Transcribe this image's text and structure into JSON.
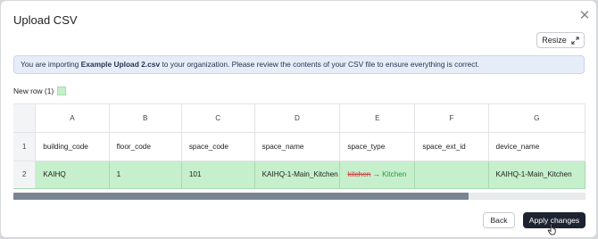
{
  "modal": {
    "title": "Upload CSV",
    "close_glyph": "✕"
  },
  "toolbar": {
    "resize_label": "Resize"
  },
  "banner": {
    "prefix": "You are importing ",
    "filename": "Example Upload 2.csv",
    "suffix": " to your organization. Please review the contents of your CSV file to ensure everything is correct."
  },
  "legend": {
    "new_row_label": "New row (1)",
    "new_row_color": "#c6efcc"
  },
  "table": {
    "column_letters": [
      "A",
      "B",
      "C",
      "D",
      "E",
      "F",
      "G"
    ],
    "row_numbers": [
      "1",
      "2"
    ],
    "headers": [
      "building_code",
      "floor_code",
      "space_code",
      "space_name",
      "space_type",
      "space_ext_id",
      "device_name"
    ],
    "rows": [
      {
        "building_code": "KAIHQ",
        "floor_code": "1",
        "space_code": "101",
        "space_name": "KAIHQ-1-Main_Kitchen",
        "space_type_old": "kitchen",
        "space_type_arrow": "→",
        "space_type_new": "Kitchen",
        "space_ext_id": "",
        "device_name": "KAIHQ-1-Main_Kitchen"
      }
    ]
  },
  "actions": {
    "back_label": "Back",
    "apply_label": "Apply changes"
  },
  "colors": {
    "new_row": "#c6efcc",
    "primary_button": "#1d2330",
    "old_value": "#d04040",
    "new_value": "#2b9b44"
  },
  "icons": {
    "close": "close-icon",
    "resize": "resize-icon",
    "cursor": "hand-pointer-icon"
  }
}
